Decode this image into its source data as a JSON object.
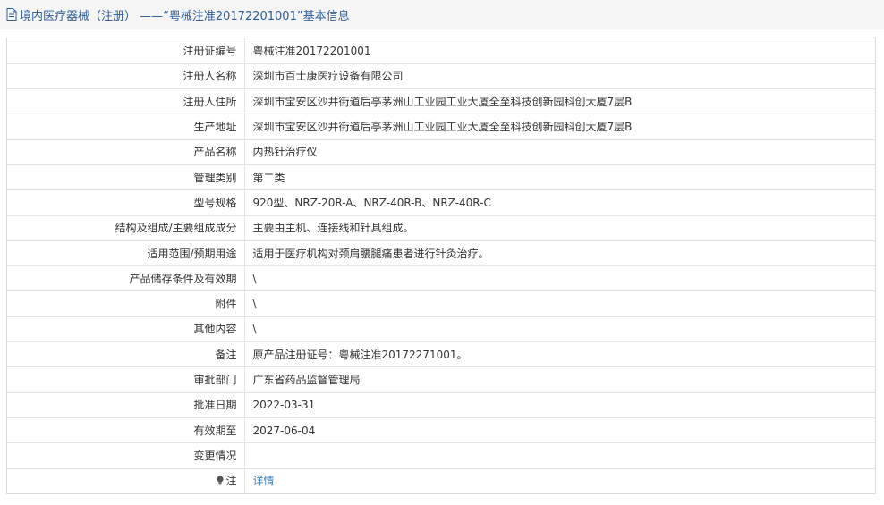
{
  "page": {
    "title": "境内医疗器械（注册） ——“粤械注准20172201001”基本信息"
  },
  "rows": [
    {
      "label": "注册证编号",
      "value": "粤械注准20172201001"
    },
    {
      "label": "注册人名称",
      "value": "深圳市百士康医疗设备有限公司"
    },
    {
      "label": "注册人住所",
      "value": "深圳市宝安区沙井街道后亭茅洲山工业园工业大厦全至科技创新园科创大厦7层B"
    },
    {
      "label": "生产地址",
      "value": "深圳市宝安区沙井街道后亭茅洲山工业园工业大厦全至科技创新园科创大厦7层B"
    },
    {
      "label": "产品名称",
      "value": "内热针治疗仪"
    },
    {
      "label": "管理类别",
      "value": "第二类"
    },
    {
      "label": "型号规格",
      "value": "920型、NRZ-20R-A、NRZ-40R-B、NRZ-40R-C"
    },
    {
      "label": "结构及组成/主要组成成分",
      "value": "主要由主机、连接线和针具组成。"
    },
    {
      "label": "适用范围/预期用途",
      "value": "适用于医疗机构对颈肩腰腿痛患者进行针灸治疗。"
    },
    {
      "label": "产品储存条件及有效期",
      "value": "\\"
    },
    {
      "label": "附件",
      "value": "\\"
    },
    {
      "label": "其他内容",
      "value": "\\"
    },
    {
      "label": "备注",
      "value": "原产品注册证号：粤械注准20172271001。"
    },
    {
      "label": "审批部门",
      "value": "广东省药品监督管理局"
    },
    {
      "label": "批准日期",
      "value": "2022-03-31"
    },
    {
      "label": "有效期至",
      "value": "2027-06-04"
    },
    {
      "label": "变更情况",
      "value": ""
    }
  ],
  "note": {
    "label": "注",
    "link": "详情",
    "icon": "lightbulb-icon"
  },
  "colors": {
    "title": "#2c5d99",
    "link": "#3b7dc4"
  }
}
